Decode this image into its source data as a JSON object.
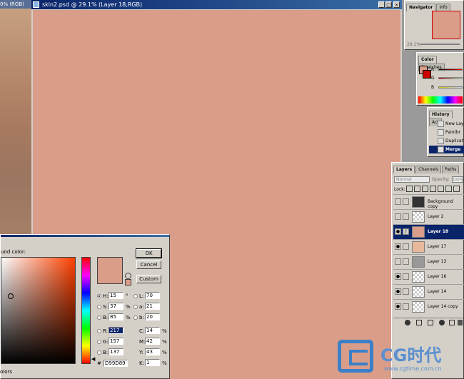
{
  "background_doc": {
    "title_fragment": "0% (RGB)"
  },
  "document": {
    "title": "skin2.psd @ 29.1% (Layer 18,RGB)",
    "window_buttons": [
      "_",
      "□",
      "×"
    ],
    "canvas_color": "#D99D89"
  },
  "navigator": {
    "tabs": [
      "Navigator",
      "Info"
    ],
    "zoom": "29.1%"
  },
  "color_palette": {
    "tabs": [
      "Color",
      "Swatches"
    ],
    "channels": [
      "R",
      "G",
      "B"
    ]
  },
  "history": {
    "tabs": [
      "History",
      "Act"
    ],
    "items": [
      "New Lay",
      "Paintbr",
      "Duplicat",
      "Merge"
    ]
  },
  "layers": {
    "tabs": [
      "Layers",
      "Channels",
      "Paths"
    ],
    "blend_mode": "Normal",
    "opacity_label": "Opacity:",
    "opacity_value": "100%",
    "lock_label": "Lock:",
    "items": [
      {
        "name": "Background copy",
        "visible": false
      },
      {
        "name": "Layer 2",
        "visible": false
      },
      {
        "name": "Layer 18",
        "visible": true,
        "selected": true
      },
      {
        "name": "Layer 17",
        "visible": true
      },
      {
        "name": "Layer 13",
        "visible": false
      },
      {
        "name": "Layer 16",
        "visible": true
      },
      {
        "name": "Layer 14",
        "visible": true
      },
      {
        "name": "Layer 14 copy",
        "visible": true
      }
    ]
  },
  "color_picker": {
    "label": "und color:",
    "buttons": {
      "ok": "OK",
      "cancel": "Cancel",
      "custom": "Custom"
    },
    "fields": {
      "H": {
        "value": "15",
        "unit": "°"
      },
      "S": {
        "value": "37",
        "unit": "%"
      },
      "B": {
        "value": "85",
        "unit": "%"
      },
      "R": {
        "value": "217",
        "unit": ""
      },
      "G": {
        "value": "157",
        "unit": ""
      },
      "Bl": {
        "label": "B:",
        "value": "137",
        "unit": ""
      },
      "L": {
        "value": "70",
        "unit": ""
      },
      "a": {
        "value": "21",
        "unit": ""
      },
      "b": {
        "value": "20",
        "unit": ""
      },
      "C": {
        "value": "14",
        "unit": "%"
      },
      "M": {
        "value": "42",
        "unit": "%"
      },
      "Y": {
        "value": "43",
        "unit": "%"
      },
      "K": {
        "value": "1",
        "unit": "%"
      }
    },
    "hex_label": "#",
    "hex": "D99D89",
    "colors_label": "olors"
  },
  "watermark": {
    "text": "CG时代",
    "url": "www.cgtime.com.cn"
  }
}
